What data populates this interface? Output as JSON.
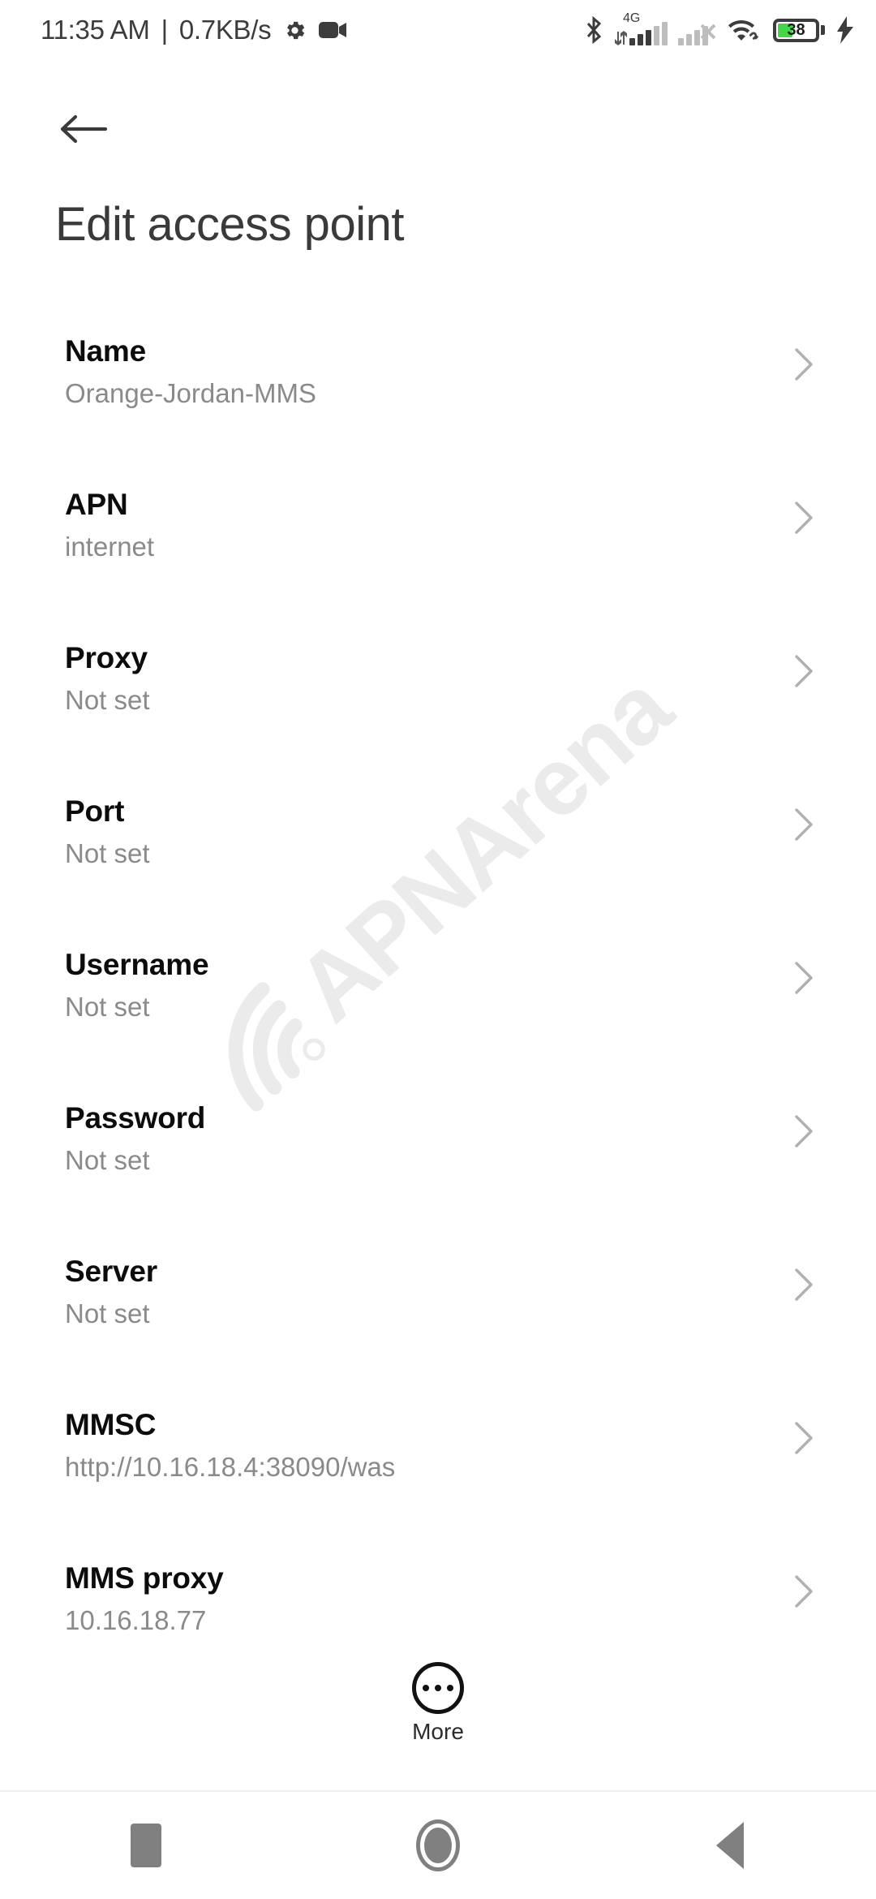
{
  "status_bar": {
    "clock": "11:35 AM",
    "separator": "|",
    "net_speed": "0.7KB/s",
    "left_icons": [
      "gear-icon",
      "video-camera-icon"
    ],
    "right_icons": [
      "bluetooth-icon",
      "signal-4g-icon",
      "signal-sim2-no-service-icon",
      "wifi-icon",
      "battery-icon",
      "charging-bolt-icon"
    ],
    "network_type": "4G",
    "battery_percent": "38",
    "battery_charging": true,
    "sim1_bars": 5,
    "sim1_active_bars": 3,
    "sim2_bars": 4,
    "sim2_active_bars": 0,
    "colors": {
      "icon": "#3c3c3c",
      "battery_fill": "#43d64b",
      "dim": "#bdbdbd"
    }
  },
  "header": {
    "back_icon": "arrow-left-icon",
    "title": "Edit access point"
  },
  "watermark": {
    "text": "APNArena",
    "icon": "wifi-signal-icon",
    "color": "#ebebeb"
  },
  "list": {
    "chevron_icon": "chevron-right-icon",
    "rows": [
      {
        "title": "Name",
        "value": "Orange-Jordan-MMS"
      },
      {
        "title": "APN",
        "value": "internet"
      },
      {
        "title": "Proxy",
        "value": "Not set"
      },
      {
        "title": "Port",
        "value": "Not set"
      },
      {
        "title": "Username",
        "value": "Not set"
      },
      {
        "title": "Password",
        "value": "Not set"
      },
      {
        "title": "Server",
        "value": "Not set"
      },
      {
        "title": "MMSC",
        "value": "http://10.16.18.4:38090/was"
      },
      {
        "title": "MMS proxy",
        "value": "10.16.18.77"
      }
    ]
  },
  "more_button": {
    "label": "More",
    "icon": "more-dots-circle-icon"
  },
  "nav_bar": {
    "recents_label": "recents-square-icon",
    "home_label": "home-circle-icon",
    "back_label": "back-triangle-icon"
  }
}
